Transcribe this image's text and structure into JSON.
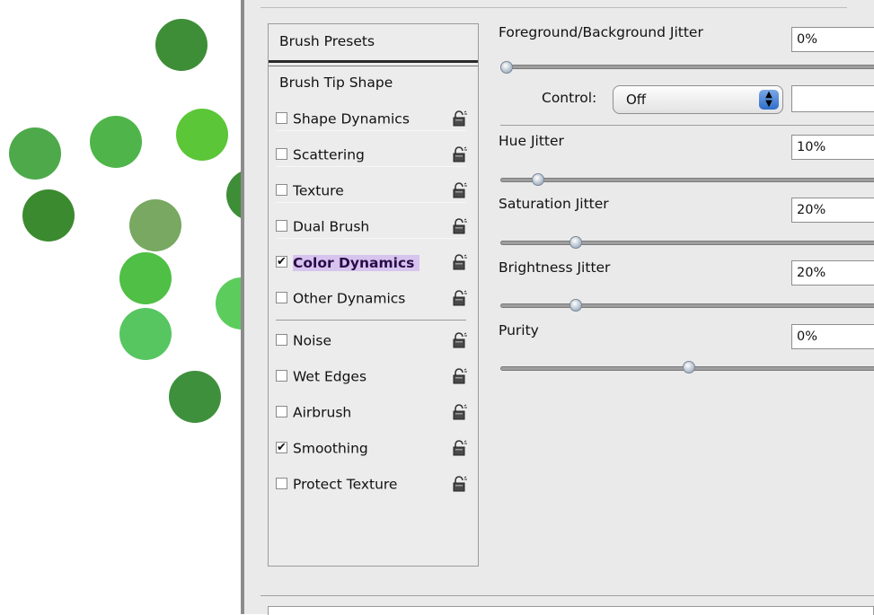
{
  "options": {
    "brush_presets": "Brush Presets",
    "brush_tip_shape": "Brush Tip Shape",
    "items": [
      {
        "label": "Shape Dynamics",
        "checked": false
      },
      {
        "label": "Scattering",
        "checked": false
      },
      {
        "label": "Texture",
        "checked": false
      },
      {
        "label": "Dual Brush",
        "checked": false
      },
      {
        "label": "Color Dynamics",
        "checked": true,
        "selected": true
      },
      {
        "label": "Other Dynamics",
        "checked": false
      },
      {
        "label": "Noise",
        "checked": false
      },
      {
        "label": "Wet Edges",
        "checked": false
      },
      {
        "label": "Airbrush",
        "checked": false
      },
      {
        "label": "Smoothing",
        "checked": true
      },
      {
        "label": "Protect Texture",
        "checked": false
      }
    ],
    "check_glyph": "✔"
  },
  "controls": {
    "fg_bg_jitter": {
      "label": "Foreground/Background Jitter",
      "value": "0%",
      "level": 0
    },
    "control": {
      "label": "Control:",
      "value": "Off",
      "arrow": "▲▼"
    },
    "hue_jitter": {
      "label": "Hue Jitter",
      "value": "10%",
      "level": 0.1
    },
    "saturation_jitter": {
      "label": "Saturation Jitter",
      "value": "20%",
      "level": 0.2
    },
    "brightness_jitter": {
      "label": "Brightness Jitter",
      "value": "20%",
      "level": 0.2
    },
    "purity": {
      "label": "Purity",
      "value": "0%",
      "level": 0.5
    }
  },
  "colors": {
    "selection_highlight": "#d7c4ee",
    "dots": [
      "#3e8e38",
      "#4ea94a",
      "#4fb54a",
      "#5bc637",
      "#3c8a2f",
      "#78a861",
      "#4fbf45",
      "#5ccd5c",
      "#57c661",
      "#3f903c"
    ]
  },
  "icons": {
    "lock": "lock-icon",
    "checkbox": "checkbox-icon",
    "select_arrows": "stepper-arrows-icon"
  }
}
